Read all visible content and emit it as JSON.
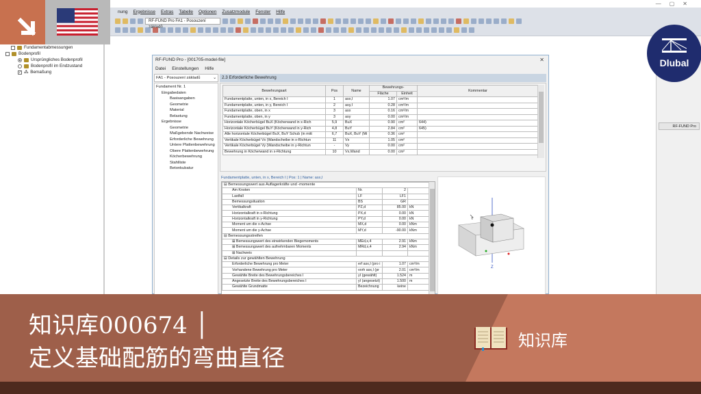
{
  "app": {
    "menu": [
      "Ergebnisse",
      "Extras",
      "Tabelle",
      "Optionen",
      "Zusatzmodule",
      "Fenster",
      "Hilfe"
    ],
    "menu_partial": "nung",
    "module_combo": "RF-FUND Pro FA1 - Posouzení základů"
  },
  "left_tree": [
    {
      "label": "Fundamentabmessungen",
      "control": "checkbox",
      "checked": false
    },
    {
      "label": "Bodenprofil",
      "control": "checkbox",
      "checked": false
    },
    {
      "label": "Ursprüngliches Bodenprofil",
      "control": "radio",
      "checked": true
    },
    {
      "label": "Bodenprofil im Endzustand",
      "control": "radio",
      "checked": false
    },
    {
      "label": "Bemaßung",
      "control": "checkbox",
      "checked": true
    }
  ],
  "right_panel": {
    "button": "RF-FUND Pro"
  },
  "logo": {
    "text": "Dlubal"
  },
  "dialog": {
    "title": "RF-FUND Pro - [001705-model-file]",
    "close": "✕",
    "menu": [
      "Datei",
      "Einstellungen",
      "Hilfe"
    ],
    "case_combo": "FA1 - Posouzení základů",
    "nav": {
      "root": "Fundament Nr. 1",
      "groups": [
        {
          "label": "Eingabedaten",
          "items": [
            "Basisangaben",
            "Geometrie",
            "Material",
            "Belastung"
          ]
        },
        {
          "label": "Ergebnisse",
          "items": [
            "Geometrie",
            "Maßgebende Nachweise",
            "Erforderliche Bewehrung",
            "Untere Plattenbewehrung",
            "Obere Plattenbewehrung",
            "Köcherbewehrung",
            "Stahlliste",
            "Betonkubatur"
          ]
        }
      ]
    },
    "section_title": "2.3 Erforderliche Bewehrung",
    "upper_table": {
      "group_header": "Bewehrungs-",
      "headers": [
        "Bewehrungsart",
        "Pos",
        "Name",
        "Fläche",
        "Einheit",
        "Kommentar"
      ],
      "rows": [
        [
          "Fundamentplatte, unten, in x, Bereich I",
          "1",
          "asx,I",
          "1.07",
          "cm²/m",
          ""
        ],
        [
          "Fundamentplatte, unten, in y, Bereich I",
          "2",
          "asy,I",
          "0.28",
          "cm²/m",
          ""
        ],
        [
          "Fundamentplatte, oben, in x",
          "3",
          "asx",
          "0.16",
          "cm²/m",
          ""
        ],
        [
          "Fundamentplatte, oben, in y",
          "3",
          "asy",
          "0.00",
          "cm²/m",
          ""
        ],
        [
          "Horizontale Köcherbügel BuX (Köcherwand in x-Rich",
          "5,9",
          "BuX",
          "0.90",
          "cm²",
          "644)"
        ],
        [
          "Horizontale Köcherbügel BuY (Köcherwand in y-Rich",
          "4,8",
          "BuY",
          "2.84",
          "cm²",
          "645)"
        ],
        [
          "Alle horizontale Köcherbügel BuX, BuY Schub (in mitt",
          "6,7",
          "BuX, BuY (Mi",
          "0.36",
          "cm²",
          ""
        ],
        [
          "Vertikale Köcherbügel Vx (Wandscheibe in x-Richtun",
          "11",
          "Vx",
          "1.05",
          "cm²",
          ""
        ],
        [
          "Vertikale Köcherbügel Vy (Wandscheibe in y-Richtun",
          "-",
          "Vy",
          "0.00",
          "cm²",
          ""
        ],
        [
          "Bewehrung in Köcherwand in x-Richtung",
          "10",
          "Vx,Wand",
          "0.00",
          "cm²",
          ""
        ]
      ]
    },
    "detail_caption": "Fundamentplatte, unten, in x, Bereich I | Pos: 1 | Name: asx,I",
    "detail_rows": [
      {
        "group": "⊟ Bemessungswert aus Auflagerkräfte und -momente"
      },
      {
        "cells": [
          "Am Knoten",
          "Nr.",
          "2",
          ""
        ]
      },
      {
        "cells": [
          "Lastfall",
          "LF",
          "LF1",
          ""
        ]
      },
      {
        "cells": [
          "Bemessungsituation",
          "BS",
          "GR",
          ""
        ]
      },
      {
        "cells": [
          "Vertikalkraft",
          "PZ,d",
          "85.00",
          "kN"
        ]
      },
      {
        "cells": [
          "Horizontalkraft in x-Richtung",
          "PX,d",
          "0.00",
          "kN"
        ]
      },
      {
        "cells": [
          "Horizontalkraft in y-Richtung",
          "PY,d",
          "0.00",
          "kN"
        ]
      },
      {
        "cells": [
          "Moment um die x-Achse",
          "MX,d",
          "0.00",
          "kNm"
        ]
      },
      {
        "cells": [
          "Moment um die y-Achse",
          "MY,d",
          "-90.00",
          "kNm"
        ]
      },
      {
        "group": "⊟ Bemessungsstreifen"
      },
      {
        "cells": [
          "⊞ Bemessungswert des einwirkenden Biegemoments",
          "MEd,x,4",
          "2.91",
          "kNm"
        ]
      },
      {
        "cells": [
          "⊞ Bemessungswert des aufnehmbaren Moments",
          "MRd,x,4",
          "2.94",
          "kNm"
        ]
      },
      {
        "cells": [
          "⊞ Nachweis",
          "",
          "",
          ""
        ]
      },
      {
        "group": "⊟ Details zur gewählten Bewehrung"
      },
      {
        "cells": [
          "Erforderliche Bewehrung pro Meter",
          "erf asx,I (pro i",
          "1.07",
          "cm²/m"
        ]
      },
      {
        "cells": [
          "Vorhandene Bewehrung pro Meter",
          "vorh asx,I (pr",
          "2.01",
          "cm²/m"
        ]
      },
      {
        "cells": [
          "Gewählte Breite des Bewehrungsbereiches I",
          "yI (gewählt)",
          "1.524",
          "m"
        ]
      },
      {
        "cells": [
          "Angesetzte Breite des Bewehrungsbereiches I",
          "yI (angesetzt)",
          "1.500",
          "m"
        ]
      },
      {
        "cells": [
          "Gewählte Grundmatte",
          "Bezeichnung",
          "keine",
          ""
        ]
      }
    ],
    "preview_axis": "Z"
  },
  "banner": {
    "title_line1": "知识库000674 │",
    "title_line2": "定义基础配筋的弯曲直径",
    "category": "知识库"
  },
  "colors": {
    "banner_dark": "#9e5f4a",
    "banner_light": "#c4785e",
    "strip": "#4e2a1e",
    "logo": "#1f2c6e",
    "corner": "#c8714f"
  }
}
